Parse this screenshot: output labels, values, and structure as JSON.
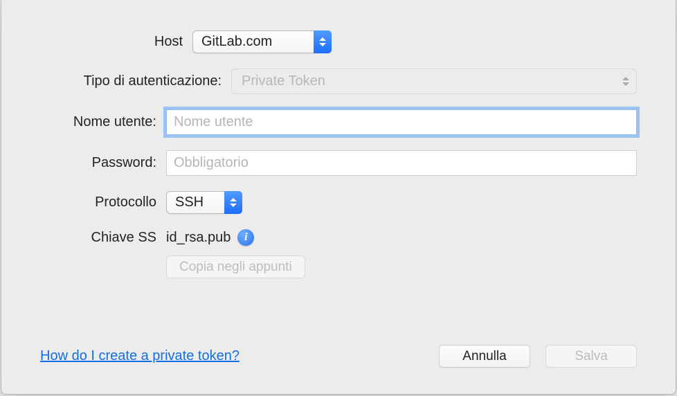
{
  "labels": {
    "host": "Host",
    "auth_type": "Tipo di autenticazione:",
    "username": "Nome utente:",
    "password": "Password:",
    "protocol": "Protocollo",
    "ssh_key": "Chiave SS"
  },
  "host": {
    "value": "GitLab.com"
  },
  "auth_type": {
    "value": "Private Token"
  },
  "username": {
    "value": "",
    "placeholder": "Nome utente"
  },
  "password": {
    "value": "",
    "placeholder": "Obbligatorio"
  },
  "protocol": {
    "value": "SSH"
  },
  "ssh_key": {
    "file": "id_rsa.pub"
  },
  "buttons": {
    "copy_clipboard": "Copia negli appunti",
    "cancel": "Annulla",
    "save": "Salva"
  },
  "help_link": "How do I create a private token?",
  "colors": {
    "accent": "#2a71e8",
    "focus_ring": "#5ba0f6"
  }
}
